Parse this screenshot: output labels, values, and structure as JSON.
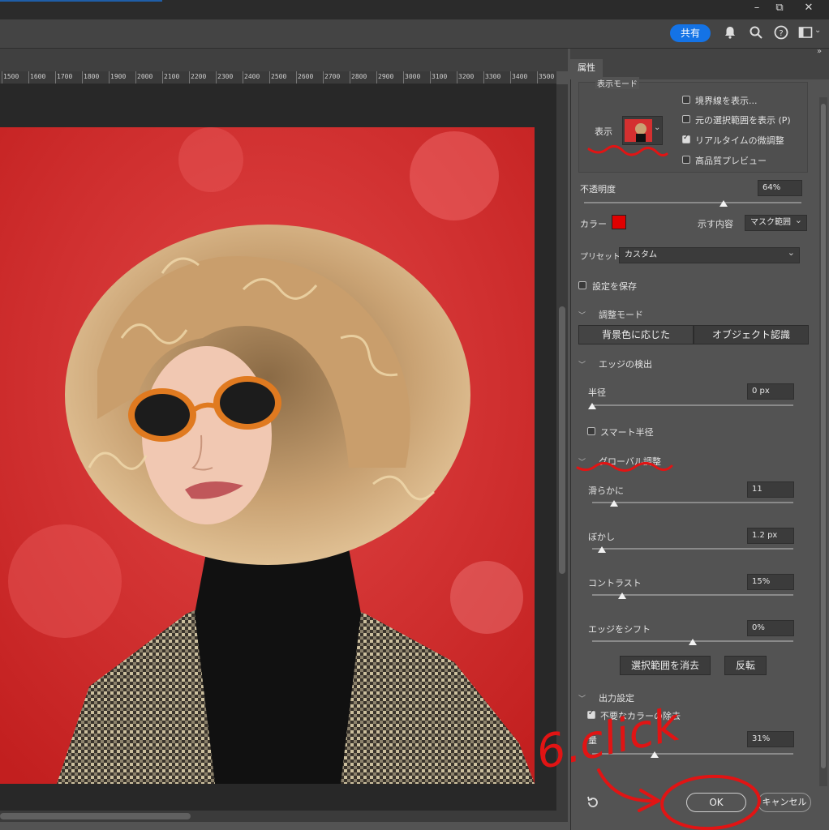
{
  "window": {
    "minimize": "–",
    "restore": "⧉",
    "close": "✕"
  },
  "optionbar": {
    "share_label": "共有",
    "more_label": "»"
  },
  "ruler": {
    "ticks": [
      "1500",
      "1600",
      "1700",
      "1800",
      "1900",
      "2000",
      "2100",
      "2200",
      "2300",
      "2400",
      "2500",
      "2600",
      "2700",
      "2800",
      "2900",
      "3000",
      "3100",
      "3200",
      "3300",
      "3400",
      "3500"
    ]
  },
  "panel": {
    "tab_label": "属性",
    "view_mode": {
      "group_label": "表示モード",
      "view_label": "表示",
      "show_edges": "境界線を表示...",
      "show_original": "元の選択範囲を表示 (P)",
      "realtime": "リアルタイムの微調整",
      "hq_preview": "高品質プレビュー"
    },
    "opacity": {
      "label": "不透明度",
      "value": "64%",
      "level": 0.64
    },
    "color": {
      "label": "カラー",
      "swatch": "#e00000",
      "indicates_label": "示す内容",
      "indicates_value": "マスク範囲"
    },
    "preset": {
      "label": "プリセット",
      "value": "カスタム"
    },
    "save_settings": "設定を保存",
    "refine_mode": {
      "title": "調整モード",
      "color_aware": "背景色に応じた",
      "object_aware": "オブジェクト認識"
    },
    "edge_detection": {
      "title": "エッジの検出",
      "radius_label": "半径",
      "radius_value": "0 px",
      "radius_level": 0.0,
      "smart_radius": "スマート半径"
    },
    "global_refinements": {
      "title": "グローバル調整",
      "smooth_label": "滑らかに",
      "smooth_value": "11",
      "smooth_level": 0.11,
      "feather_label": "ぼかし",
      "feather_value": "1.2 px",
      "feather_level": 0.05,
      "contrast_label": "コントラスト",
      "contrast_value": "15%",
      "contrast_level": 0.15,
      "shift_label": "エッジをシフト",
      "shift_value": "0%",
      "shift_level": 0.5,
      "clear_selection": "選択範囲を消去",
      "invert": "反転"
    },
    "output": {
      "title": "出力設定",
      "decontaminate": "不要なカラーの除去",
      "amount_label": "量",
      "amount_value": "31%",
      "amount_level": 0.31
    },
    "ok_label": "OK",
    "cancel_label": "キャンセル"
  },
  "annotation": {
    "text": "6.click",
    "color": "#e11414"
  },
  "colors": {
    "background_red": "#d93535",
    "accent_blue": "#1473e6"
  }
}
